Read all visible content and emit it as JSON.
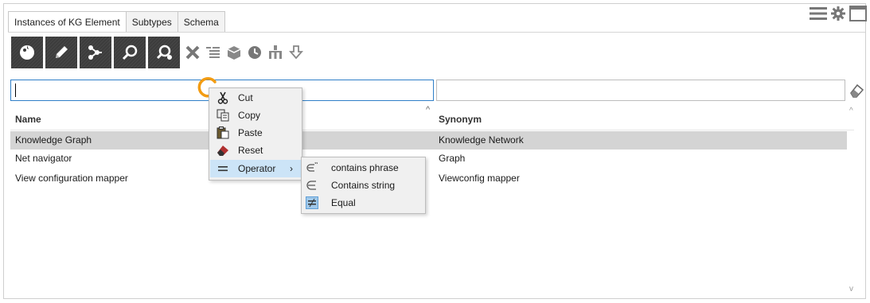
{
  "tabs": [
    {
      "label": "Instances of KG Element",
      "active": true
    },
    {
      "label": "Subtypes",
      "active": false
    },
    {
      "label": "Schema",
      "active": false
    }
  ],
  "window_icons": [
    "menu-icon",
    "gear-icon",
    "window-icon"
  ],
  "toolbar": {
    "buttons": [
      "new-instance-icon",
      "edit-pencil-icon",
      "graph-icon",
      "search-icon",
      "advanced-search-icon"
    ],
    "icons": [
      "delete-icon",
      "list-icon",
      "package-icon",
      "clock-icon",
      "hierarchy-icon",
      "import-icon"
    ]
  },
  "search": {
    "value": "",
    "secondary_value": ""
  },
  "table": {
    "columns": {
      "name": "Name",
      "synonym": "Synonym"
    },
    "rows": [
      {
        "name": "Knowledge Graph",
        "synonym": "Knowledge Network",
        "selected": true
      },
      {
        "name": "Net navigator",
        "synonym": "Graph",
        "selected": false
      },
      {
        "name": "View configuration mapper",
        "synonym": "Viewconfig mapper",
        "selected": false
      }
    ]
  },
  "context_menu": {
    "items": [
      {
        "label": "Cut",
        "icon": "scissors-icon"
      },
      {
        "label": "Copy",
        "icon": "copy-icon"
      },
      {
        "label": "Paste",
        "icon": "paste-icon"
      },
      {
        "label": "Reset",
        "icon": "eraser-icon"
      },
      {
        "label": "Operator",
        "icon": "equals-icon",
        "has_submenu": true
      }
    ],
    "submenu": [
      {
        "label": "contains phrase",
        "icon": "element-of-phrase-icon"
      },
      {
        "label": "Contains string",
        "icon": "element-of-icon"
      },
      {
        "label": "Equal",
        "icon": "checked-equal-icon",
        "checked": true
      }
    ],
    "submenu_arrow": "›"
  },
  "colors": {
    "accent": "#2f7fc8",
    "selection": "#d4d4d4",
    "menu_highlight": "#cce4f7",
    "ring": "#f39c12",
    "toolbar": "#3c3c3c"
  }
}
